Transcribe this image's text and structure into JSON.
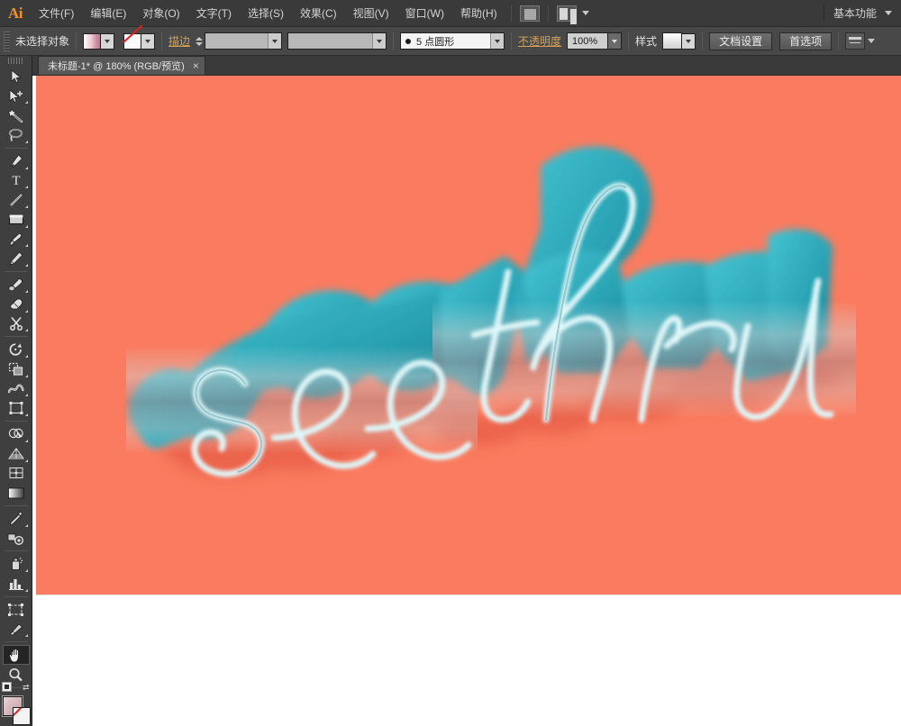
{
  "app": {
    "name": "Ai",
    "logo_color": "#f0932b"
  },
  "menubar": {
    "items": [
      {
        "label": "文件(F)",
        "name": "menu-file"
      },
      {
        "label": "编辑(E)",
        "name": "menu-edit"
      },
      {
        "label": "对象(O)",
        "name": "menu-object"
      },
      {
        "label": "文字(T)",
        "name": "menu-type"
      },
      {
        "label": "选择(S)",
        "name": "menu-select"
      },
      {
        "label": "效果(C)",
        "name": "menu-effect"
      },
      {
        "label": "视图(V)",
        "name": "menu-view"
      },
      {
        "label": "窗口(W)",
        "name": "menu-window"
      },
      {
        "label": "帮助(H)",
        "name": "menu-help"
      }
    ],
    "bridge_icon": "bridge-icon",
    "arrange_icon": "arrange-documents-icon",
    "workspace": "基本功能"
  },
  "controlbar": {
    "selection_status": "未选择对象",
    "fill_label": "fill-swatch",
    "stroke_label": "stroke-swatch",
    "stroke_word": "描边",
    "stroke_weight": "",
    "stroke_profile": "",
    "brush_definition": "5 点圆形",
    "opacity_label": "不透明度",
    "opacity_value": "100%",
    "style_label": "样式",
    "document_setup": "文档设置",
    "preferences": "首选项",
    "align_icon": "align-icon"
  },
  "document": {
    "tab_title": "未标题-1* @ 180% (RGB/预览)",
    "close_glyph": "×",
    "zoom": "180%",
    "color_mode": "RGB",
    "view_mode": "预览"
  },
  "toolbar": {
    "tools": [
      {
        "name": "selection-tool",
        "icon": "arrow-pointer-icon",
        "group": 1,
        "active": false
      },
      {
        "name": "direct-selection-tool",
        "icon": "arrow-plus-icon",
        "group": 1,
        "active": false
      },
      {
        "name": "magic-wand-tool",
        "icon": "magic-wand-icon",
        "group": 1,
        "active": false
      },
      {
        "name": "lasso-tool",
        "icon": "lasso-icon",
        "group": 1,
        "active": false
      },
      {
        "name": "pen-tool",
        "icon": "pen-nib-icon",
        "group": 2,
        "active": false
      },
      {
        "name": "type-tool",
        "icon": "type-t-icon",
        "group": 2,
        "active": false
      },
      {
        "name": "line-segment-tool",
        "icon": "line-icon",
        "group": 2,
        "active": false
      },
      {
        "name": "rectangle-tool",
        "icon": "rectangle-icon",
        "group": 2,
        "active": false
      },
      {
        "name": "paintbrush-tool",
        "icon": "paintbrush-icon",
        "group": 2,
        "active": false
      },
      {
        "name": "pencil-tool",
        "icon": "pencil-icon",
        "group": 2,
        "active": false
      },
      {
        "name": "blob-brush-tool",
        "icon": "blob-brush-icon",
        "group": 3,
        "active": false
      },
      {
        "name": "eraser-tool",
        "icon": "eraser-icon",
        "group": 3,
        "active": false
      },
      {
        "name": "scissors-tool",
        "icon": "scissors-icon",
        "group": 3,
        "active": false
      },
      {
        "name": "rotate-tool",
        "icon": "rotate-icon",
        "group": 4,
        "active": false
      },
      {
        "name": "scale-tool",
        "icon": "scale-icon",
        "group": 4,
        "active": false
      },
      {
        "name": "width-warp-tool",
        "icon": "warp-icon",
        "group": 4,
        "active": false
      },
      {
        "name": "free-transform-tool",
        "icon": "free-transform-icon",
        "group": 4,
        "active": false
      },
      {
        "name": "shape-builder-tool",
        "icon": "shape-builder-icon",
        "group": 5,
        "active": false
      },
      {
        "name": "perspective-grid-tool",
        "icon": "perspective-grid-icon",
        "group": 5,
        "active": false
      },
      {
        "name": "mesh-tool",
        "icon": "mesh-icon",
        "group": 5,
        "active": false
      },
      {
        "name": "gradient-tool",
        "icon": "gradient-icon",
        "group": 5,
        "active": false
      },
      {
        "name": "eyedropper-tool",
        "icon": "eyedropper-icon",
        "group": 6,
        "active": false
      },
      {
        "name": "blend-tool",
        "icon": "blend-icon",
        "group": 6,
        "active": false
      },
      {
        "name": "symbol-sprayer-tool",
        "icon": "symbol-sprayer-icon",
        "group": 7,
        "active": false
      },
      {
        "name": "column-graph-tool",
        "icon": "bar-chart-icon",
        "group": 7,
        "active": false
      },
      {
        "name": "artboard-tool",
        "icon": "artboard-icon",
        "group": 8,
        "active": false
      },
      {
        "name": "slice-tool",
        "icon": "slice-knife-icon",
        "group": 8,
        "active": false
      },
      {
        "name": "hand-tool",
        "icon": "hand-icon",
        "group": 9,
        "active": true
      },
      {
        "name": "zoom-tool",
        "icon": "magnifier-icon",
        "group": 9,
        "active": false
      }
    ],
    "fill_swatch": "fill-color-swatch",
    "stroke_swatch": "stroke-none-swatch"
  },
  "artwork": {
    "background_color": "#fa7b5f",
    "text": "see thru",
    "words": [
      "see",
      "thru"
    ],
    "style": "3d-extruded-script-lettering",
    "face_color_light": "#35b4c4",
    "face_color_dark": "#1c8c9c",
    "extrude_color": "#2aa0b0",
    "highlight_color": "#d8f6f8",
    "shadow_color": "#e8614a",
    "gradient_overlay": "#b08b90"
  }
}
